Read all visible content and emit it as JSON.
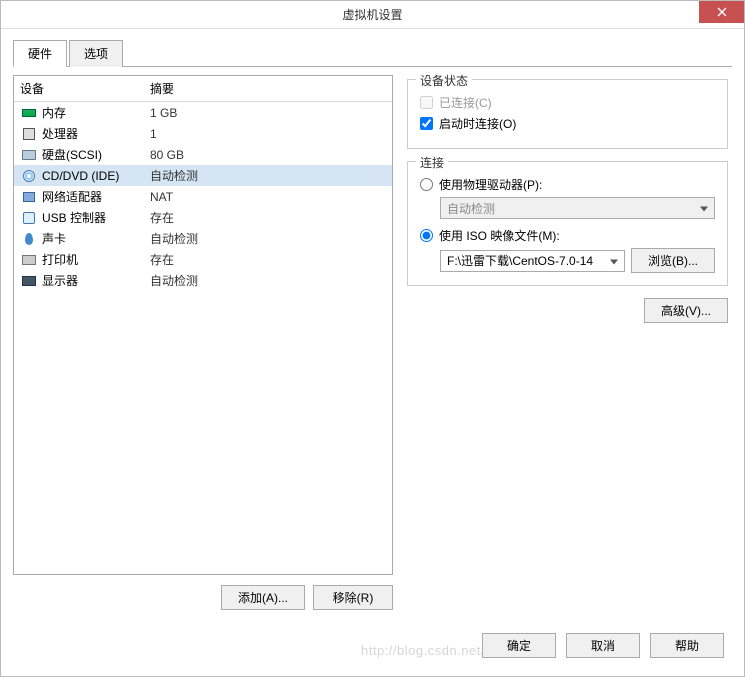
{
  "window": {
    "title": "虚拟机设置"
  },
  "tabs": {
    "hardware": "硬件",
    "options": "选项"
  },
  "table": {
    "col_device": "设备",
    "col_summary": "摘要",
    "rows": [
      {
        "name": "内存",
        "summary": "1 GB",
        "icon": "mem"
      },
      {
        "name": "处理器",
        "summary": "1",
        "icon": "cpu"
      },
      {
        "name": "硬盘(SCSI)",
        "summary": "80 GB",
        "icon": "hdd"
      },
      {
        "name": "CD/DVD (IDE)",
        "summary": "自动检测",
        "icon": "cd",
        "selected": true
      },
      {
        "name": "网络适配器",
        "summary": "NAT",
        "icon": "net"
      },
      {
        "name": "USB 控制器",
        "summary": "存在",
        "icon": "usb"
      },
      {
        "name": "声卡",
        "summary": "自动检测",
        "icon": "snd"
      },
      {
        "name": "打印机",
        "summary": "存在",
        "icon": "prn"
      },
      {
        "name": "显示器",
        "summary": "自动检测",
        "icon": "disp"
      }
    ]
  },
  "buttons": {
    "add": "添加(A)...",
    "remove": "移除(R)"
  },
  "status_group": {
    "title": "设备状态",
    "connected": "已连接(C)",
    "connect_at_power": "启动时连接(O)"
  },
  "conn_group": {
    "title": "连接",
    "physical": "使用物理驱动器(P):",
    "physical_value": "自动检测",
    "iso": "使用 ISO 映像文件(M):",
    "iso_value": "F:\\迅雷下载\\CentOS-7.0-14",
    "browse": "浏览(B)..."
  },
  "advanced": "高级(V)...",
  "footer": {
    "ok": "确定",
    "cancel": "取消",
    "help": "帮助"
  },
  "watermark": "http://blog.csdn.net/baigoocn"
}
